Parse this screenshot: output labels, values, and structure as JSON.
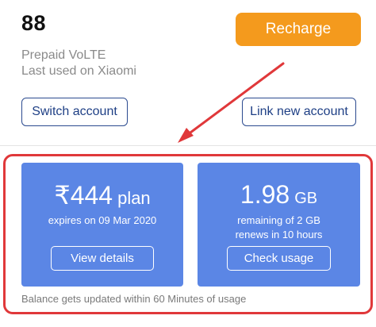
{
  "account": {
    "number": "88",
    "plan_type": "Prepaid VoLTE",
    "last_used": "Last used on Xiaomi"
  },
  "actions": {
    "recharge_label": "Recharge",
    "switch_label": "Switch account",
    "link_label": "Link new account"
  },
  "plan_card": {
    "currency": "₹",
    "amount": "444",
    "suffix": "plan",
    "expiry": "expires on 09 Mar 2020",
    "button_label": "View details"
  },
  "data_card": {
    "amount": "1.98",
    "unit": "GB",
    "remaining": "remaining of 2 GB",
    "renews": "renews in 10 hours",
    "button_label": "Check usage"
  },
  "footnote": "Balance gets updated within 60 Minutes of usage",
  "colors": {
    "accent_orange": "#f49a1d",
    "card_blue": "#5b86e5",
    "annotation_red": "#e0383a",
    "button_navy": "#1e3f85"
  }
}
